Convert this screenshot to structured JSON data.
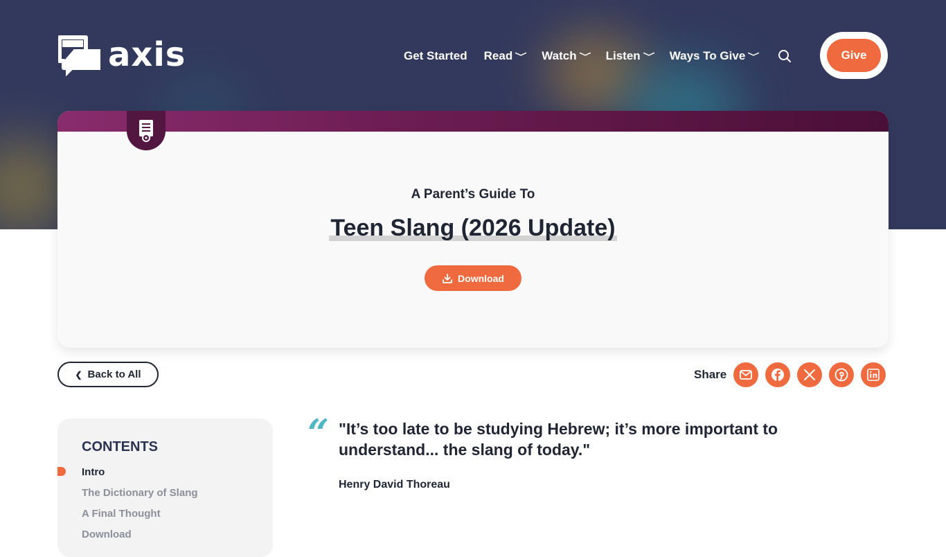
{
  "brand": {
    "name": "axis",
    "logo_quote": "“"
  },
  "nav": {
    "items": [
      {
        "label": "Get Started",
        "has_dropdown": false
      },
      {
        "label": "Read",
        "has_dropdown": true
      },
      {
        "label": "Watch",
        "has_dropdown": true
      },
      {
        "label": "Listen",
        "has_dropdown": true
      },
      {
        "label": "Ways To Give",
        "has_dropdown": true
      }
    ],
    "chevron": "⌄",
    "search_icon": "search-icon",
    "give_label": "Give"
  },
  "guide": {
    "icon": "guide-document-icon",
    "subtitle": "A Parent’s Guide To",
    "title": "Teen Slang (2026 Update)",
    "download_label": "Download"
  },
  "back_label": "Back to All",
  "back_chevron": "❮",
  "share": {
    "label": "Share",
    "buttons": [
      "email-icon",
      "facebook-icon",
      "x-icon",
      "pinterest-icon",
      "linkedin-icon"
    ]
  },
  "contents": {
    "title": "CONTENTS",
    "items": [
      {
        "label": "Intro",
        "active": true
      },
      {
        "label": "The Dictionary of Slang",
        "active": false
      },
      {
        "label": "A Final Thought",
        "active": false
      },
      {
        "label": "Download",
        "active": false
      }
    ]
  },
  "quote": {
    "mark": "“",
    "text": "\"It’s too late to be studying Hebrew; it’s more important to understand... the slang of today.\"",
    "author": "Henry David Thoreau"
  },
  "colors": {
    "hero_bg": "#32395d",
    "accent": "#ef6a3f",
    "card_bar": "#6a1c50",
    "quote_mark": "#4fb7c4",
    "text_dark": "#1f2533"
  }
}
